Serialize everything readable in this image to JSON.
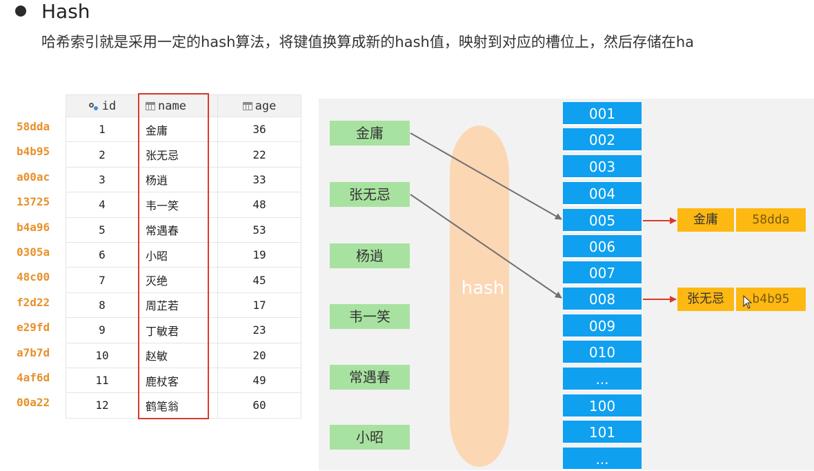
{
  "heading": "Hash",
  "description": "哈希索引就是采用一定的hash算法，将键值换算成新的hash值，映射到对应的槽位上，然后存储在ha",
  "table": {
    "headers": [
      "id",
      "name",
      "age"
    ],
    "rows": [
      {
        "hash": "58dda",
        "id": "1",
        "name": "金庸",
        "age": "36"
      },
      {
        "hash": "b4b95",
        "id": "2",
        "name": "张无忌",
        "age": "22"
      },
      {
        "hash": "a00ac",
        "id": "3",
        "name": "杨逍",
        "age": "33"
      },
      {
        "hash": "13725",
        "id": "4",
        "name": "韦一笑",
        "age": "48"
      },
      {
        "hash": "b4a96",
        "id": "5",
        "name": "常遇春",
        "age": "53"
      },
      {
        "hash": "0305a",
        "id": "6",
        "name": "小昭",
        "age": "19"
      },
      {
        "hash": "48c00",
        "id": "7",
        "name": "灭绝",
        "age": "45"
      },
      {
        "hash": "f2d22",
        "id": "8",
        "name": "周芷若",
        "age": "17"
      },
      {
        "hash": "e29fd",
        "id": "9",
        "name": "丁敏君",
        "age": "23"
      },
      {
        "hash": "a7b7d",
        "id": "10",
        "name": "赵敏",
        "age": "20"
      },
      {
        "hash": "4af6d",
        "id": "11",
        "name": "鹿杖客",
        "age": "49"
      },
      {
        "hash": "00a22",
        "id": "12",
        "name": "鹤笔翁",
        "age": "60"
      }
    ]
  },
  "diagram": {
    "names": [
      "金庸",
      "张无忌",
      "杨逍",
      "韦一笑",
      "常遇春",
      "小昭"
    ],
    "hash_label": "hash",
    "slots": [
      "001",
      "002",
      "003",
      "004",
      "005",
      "006",
      "007",
      "008",
      "009",
      "010",
      "...",
      "100",
      "101",
      "..."
    ],
    "entries": [
      {
        "slot": "005",
        "name": "金庸",
        "hash": "58dda"
      },
      {
        "slot": "008",
        "name": "张无忌",
        "hash": "b4b95"
      }
    ],
    "colors": {
      "name_node": "#a8e2a0",
      "slot": "#0fa0f0",
      "entry": "#fdb811",
      "hash_band": "#fcd7b4",
      "highlight": "#d8392b"
    }
  }
}
